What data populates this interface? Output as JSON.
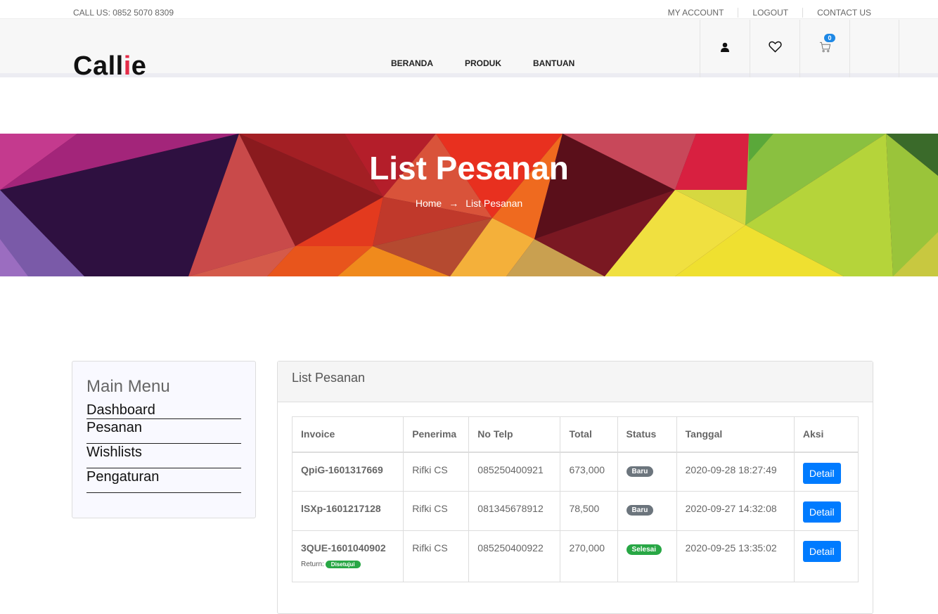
{
  "topbar": {
    "call": "CALL US: 0852 5070 8309",
    "links": [
      "MY ACCOUNT",
      "LOGOUT",
      "CONTACT US"
    ]
  },
  "header": {
    "logo_main": "Call",
    "logo_i": "i",
    "logo_end": "e",
    "nav": [
      "BERANDA",
      "PRODUK",
      "BANTUAN"
    ],
    "cart_count": "0",
    "icons": [
      "user-icon",
      "heart-icon",
      "cart-icon"
    ]
  },
  "banner": {
    "title": "List Pesanan",
    "crumb_home": "Home",
    "crumb_arrow": "→",
    "crumb_current": "List Pesanan"
  },
  "sidebar": {
    "title": "Main Menu",
    "items": [
      "Dashboard",
      "Pesanan",
      "Wishlists",
      "Pengaturan"
    ]
  },
  "panel": {
    "title": "List Pesanan",
    "columns": [
      "Invoice",
      "Penerima",
      "No Telp",
      "Total",
      "Status",
      "Tanggal",
      "Aksi"
    ],
    "rows": [
      {
        "invoice": "QpiG-1601317669",
        "penerima": "Rifki CS",
        "telp": "085250400921",
        "total": "673,000",
        "status": "Baru",
        "tanggal": "2020-09-28 18:27:49",
        "aksi": "Detail"
      },
      {
        "invoice": "lSXp-1601217128",
        "penerima": "Rifki CS",
        "telp": "081345678912",
        "total": "78,500",
        "status": "Baru",
        "tanggal": "2020-09-27 14:32:08",
        "aksi": "Detail"
      },
      {
        "invoice": "3QUE-1601040902",
        "return_label": "Return:",
        "return_status": "Disetujui",
        "penerima": "Rifki CS",
        "telp": "085250400922",
        "total": "270,000",
        "status": "Selesai",
        "tanggal": "2020-09-25 13:35:02",
        "aksi": "Detail"
      }
    ]
  },
  "colors": {
    "accent": "#007bff",
    "logo_accent": "#e42c48",
    "status_new": "#6c757d",
    "status_done": "#28a745"
  }
}
